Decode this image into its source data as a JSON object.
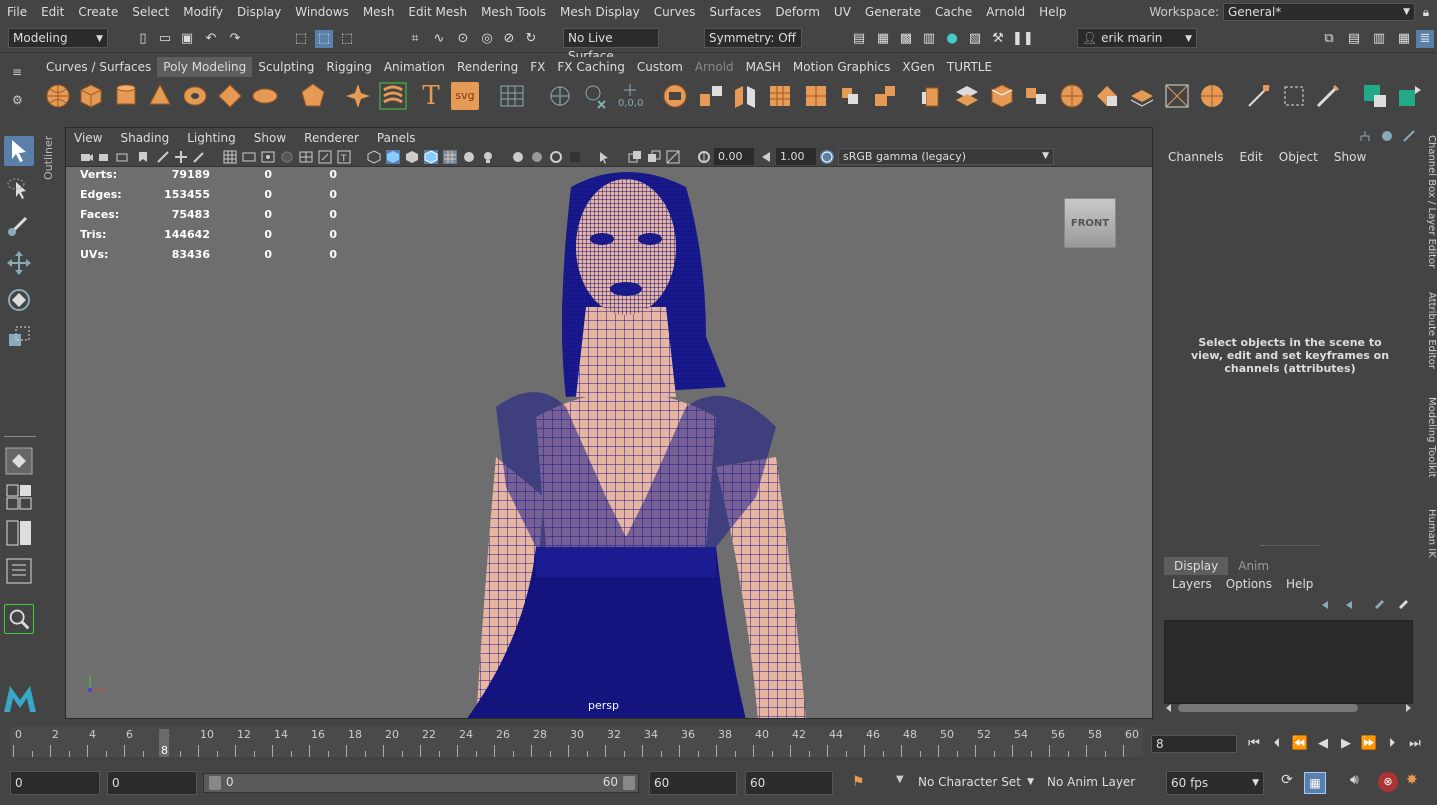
{
  "menubar": {
    "items": [
      "File",
      "Edit",
      "Create",
      "Select",
      "Modify",
      "Display",
      "Windows",
      "Mesh",
      "Edit Mesh",
      "Mesh Tools",
      "Mesh Display",
      "Curves",
      "Surfaces",
      "Deform",
      "UV",
      "Generate",
      "Cache",
      "Arnold",
      "Help"
    ],
    "workspace_label": "Workspace:",
    "workspace_value": "General*"
  },
  "statusline": {
    "mode": "Modeling",
    "live_surface": "No Live Surface",
    "symmetry": "Symmetry: Off",
    "user": "erik marin"
  },
  "shelf": {
    "tabs": [
      "Curves / Surfaces",
      "Poly Modeling",
      "Sculpting",
      "Rigging",
      "Animation",
      "Rendering",
      "FX",
      "FX Caching",
      "Custom",
      "Arnold",
      "MASH",
      "Motion Graphics",
      "XGen",
      "TURTLE"
    ],
    "active_tab": "Poly Modeling",
    "text_icon": "T",
    "svg_icon": "svg"
  },
  "outliner_label": "Outliner",
  "viewport": {
    "menu": [
      "View",
      "Shading",
      "Lighting",
      "Show",
      "Renderer",
      "Panels"
    ],
    "exposure": "0.00",
    "gamma": "1.00",
    "colorspace": "sRGB gamma (legacy)",
    "camera": "persp",
    "cube_label": "FRONT",
    "hud": [
      {
        "label": "Verts:",
        "value": "79189",
        "a": "0",
        "b": "0"
      },
      {
        "label": "Edges:",
        "value": "153455",
        "a": "0",
        "b": "0"
      },
      {
        "label": "Faces:",
        "value": "75483",
        "a": "0",
        "b": "0"
      },
      {
        "label": "Tris:",
        "value": "144642",
        "a": "0",
        "b": "0"
      },
      {
        "label": "UVs:",
        "value": "83436",
        "a": "0",
        "b": "0"
      }
    ]
  },
  "channel_box": {
    "menu": [
      "Channels",
      "Edit",
      "Object",
      "Show"
    ],
    "message": "Select objects in the scene to view, edit and set keyframes on channels (attributes)",
    "layer_tabs": [
      "Display",
      "Anim"
    ],
    "layer_menu": [
      "Layers",
      "Options",
      "Help"
    ]
  },
  "right_tabs": [
    "Channel Box / Layer Editor",
    "Attribute Editor",
    "Modeling Toolkit",
    "Human IK"
  ],
  "timeline": {
    "ticks": [
      "0",
      "2",
      "4",
      "6",
      "8",
      "10",
      "12",
      "14",
      "16",
      "18",
      "20",
      "22",
      "24",
      "26",
      "28",
      "30",
      "32",
      "34",
      "36",
      "38",
      "40",
      "42",
      "44",
      "46",
      "48",
      "50",
      "52",
      "54",
      "56",
      "58",
      "60"
    ],
    "current_frame": "8",
    "frame_field": "8"
  },
  "range": {
    "start": "0",
    "anim_start": "0",
    "slider_start": "0",
    "slider_end": "60",
    "anim_end": "60",
    "end": "60",
    "character_set": "No Character Set",
    "anim_layer": "No Anim Layer",
    "fps": "60 fps"
  },
  "colors": {
    "ui_bg": "#444444",
    "viewport_bg": "#6e6e6e",
    "shelf_icon": "#e59b55",
    "wire": "#1a1a9a",
    "skin": "#e8b6a0"
  }
}
